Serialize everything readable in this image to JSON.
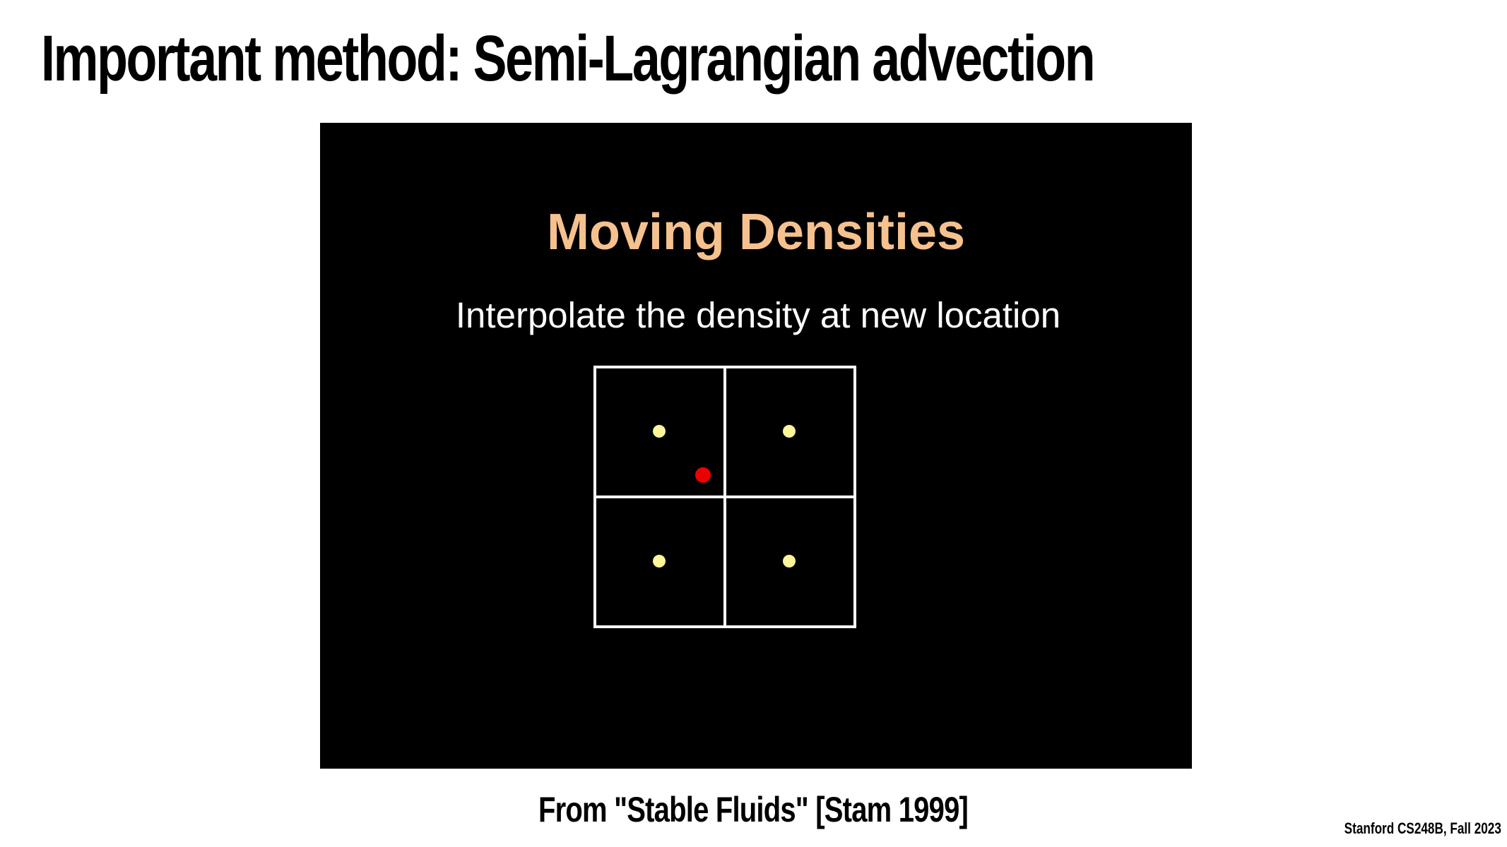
{
  "slide": {
    "title": "Important method: Semi-Lagrangian advection",
    "caption": "From \"Stable Fluids\" [Stam 1999]",
    "credit": "Stanford CS248B, Fall 2023"
  },
  "video": {
    "title": "Moving Densities",
    "subtitle": "Interpolate the density at new location"
  },
  "colors": {
    "video_background": "#000000",
    "video_title": "#f5c18e",
    "grid_lines": "#ffffff",
    "cell_center_points": "#fff59a",
    "interpolated_point": "#ee0000"
  }
}
